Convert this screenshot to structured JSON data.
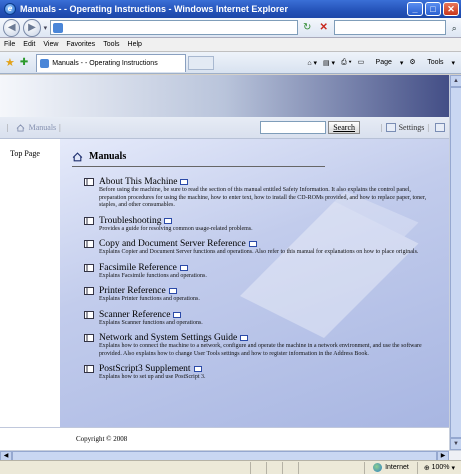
{
  "window": {
    "title": "Manuals - - Operating Instructions - Windows Internet Explorer",
    "minimize_glyph": "_",
    "maximize_glyph": "□",
    "close_glyph": "✕"
  },
  "address_bar": {
    "url": "",
    "back_glyph": "◀",
    "forward_glyph": "▶",
    "dropdown_glyph": "▾",
    "refresh_glyph": "↻",
    "stop_glyph": "✕",
    "search_glyph": "⌕"
  },
  "menu": [
    "File",
    "Edit",
    "View",
    "Favorites",
    "Tools",
    "Help"
  ],
  "tabs": {
    "active_label": "Manuals - - Operating Instructions"
  },
  "command_bar": {
    "page_label": "Page",
    "tools_label": "Tools"
  },
  "nav": {
    "manuals_label": "Manuals",
    "search_button": "Search",
    "settings_label": "Settings"
  },
  "sidebar": {
    "top_page": "Top Page"
  },
  "main": {
    "heading": "Manuals",
    "entries": [
      {
        "title": "About This Machine",
        "desc": "Before using the machine, be sure to read the section of this manual entitled Safety Information. It also explains the control panel, preparation procedures for using the machine, how to enter text, how to install the CD-ROMs provided, and how to replace paper, toner, staples, and other consumables."
      },
      {
        "title": "Troubleshooting",
        "desc": "Provides a guide for resolving common usage-related problems."
      },
      {
        "title": "Copy and Document Server Reference",
        "desc": "Explains Copier and Document Server functions and operations. Also refer to this manual for explanations on how to place originals."
      },
      {
        "title": "Facsimile Reference",
        "desc": "Explains Facsimile functions and operations."
      },
      {
        "title": "Printer Reference",
        "desc": "Explains Printer functions and operations."
      },
      {
        "title": "Scanner Reference",
        "desc": "Explains Scanner functions and operations."
      },
      {
        "title": "Network and System Settings Guide",
        "desc": "Explains how to connect the machine to a network, configure and operate the machine in a network environment, and use the software provided. Also explains how to change User Tools settings and how to register information in the Address Book."
      },
      {
        "title": "PostScript3 Supplement",
        "desc": "Explains how to set up and use PostScript 3."
      }
    ]
  },
  "footer": {
    "copyright": "Copyright © 2008"
  },
  "status": {
    "zone": "Internet",
    "zoom": "100%"
  },
  "colors": {
    "titlebar": "#2452b8",
    "content_blue": "#a8b6e2",
    "banner_dark": "#434e86"
  }
}
